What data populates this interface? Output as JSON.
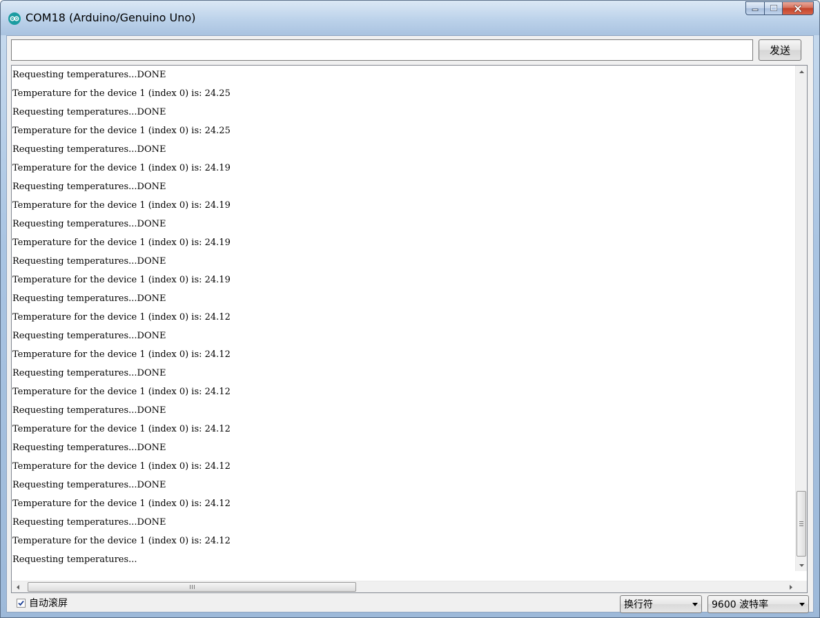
{
  "window": {
    "title": "COM18 (Arduino/Genuino Uno)",
    "icon": "arduino-icon"
  },
  "send": {
    "input_value": "",
    "button_label": "发送"
  },
  "output": {
    "lines": [
      "Requesting temperatures...DONE",
      "Temperature for the device 1 (index 0) is: 24.25",
      "Requesting temperatures...DONE",
      "Temperature for the device 1 (index 0) is: 24.25",
      "Requesting temperatures...DONE",
      "Temperature for the device 1 (index 0) is: 24.19",
      "Requesting temperatures...DONE",
      "Temperature for the device 1 (index 0) is: 24.19",
      "Requesting temperatures...DONE",
      "Temperature for the device 1 (index 0) is: 24.19",
      "Requesting temperatures...DONE",
      "Temperature for the device 1 (index 0) is: 24.19",
      "Requesting temperatures...DONE",
      "Temperature for the device 1 (index 0) is: 24.12",
      "Requesting temperatures...DONE",
      "Temperature for the device 1 (index 0) is: 24.12",
      "Requesting temperatures...DONE",
      "Temperature for the device 1 (index 0) is: 24.12",
      "Requesting temperatures...DONE",
      "Temperature for the device 1 (index 0) is: 24.12",
      "Requesting temperatures...DONE",
      "Temperature for the device 1 (index 0) is: 24.12",
      "Requesting temperatures...DONE",
      "Temperature for the device 1 (index 0) is: 24.12",
      "Requesting temperatures...DONE",
      "Temperature for the device 1 (index 0) is: 24.12",
      "Requesting temperatures..."
    ]
  },
  "footer": {
    "autoscroll_label": "自动滚屏",
    "autoscroll_checked": true,
    "line_ending": "换行符",
    "baud_rate": "9600 波特率"
  }
}
